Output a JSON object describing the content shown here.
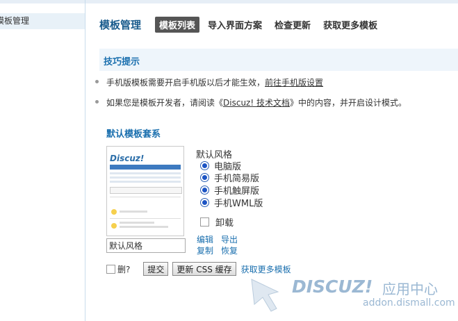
{
  "sidebar": {
    "selected_item": "模板管理"
  },
  "header": {
    "title": "模板管理",
    "tabs": [
      {
        "label": "模板列表",
        "active": true
      },
      {
        "label": "导入界面方案",
        "active": false
      },
      {
        "label": "检查更新",
        "active": false
      },
      {
        "label": "获取更多模板",
        "active": false
      }
    ]
  },
  "tips": {
    "title": "技巧提示",
    "tip1_text": "手机版模板需要开启手机版以后才能生效，",
    "tip1_link": "前往手机版设置",
    "tip2_pre": "如果您是模板开发者，请阅读《",
    "tip2_link": "Discuz! 技术文档",
    "tip2_post": "》中的内容，并开启设计模式。"
  },
  "template_set": {
    "section_title": "默认模板套系",
    "thumbnail_logo": "Discuz!",
    "style_label": "默认风格",
    "options": [
      {
        "label": "电脑版",
        "checked": true
      },
      {
        "label": "手机简易版",
        "checked": true
      },
      {
        "label": "手机触屏版",
        "checked": true
      },
      {
        "label": "手机WML版",
        "checked": true
      }
    ],
    "uninstall_label": "卸载",
    "name_value": "默认风格",
    "actions": {
      "edit": "编辑",
      "export": "导出",
      "copy": "复制",
      "restore": "恢复"
    }
  },
  "bottom": {
    "delete_label": "删?",
    "submit_label": "提交",
    "refresh_css_label": "更新 CSS 缓存",
    "more_templates_link": "获取更多模板"
  },
  "watermark": {
    "brand": "DISCUZ!",
    "cn": "应用中心",
    "url": "addon.dismall.com"
  },
  "colors": {
    "accent": "#1a6fae",
    "title": "#1a5c8d",
    "tips_bg": "#eef5fb",
    "sidebar_sel": "#e8f1f8",
    "watermark": "#9bb8d3"
  }
}
